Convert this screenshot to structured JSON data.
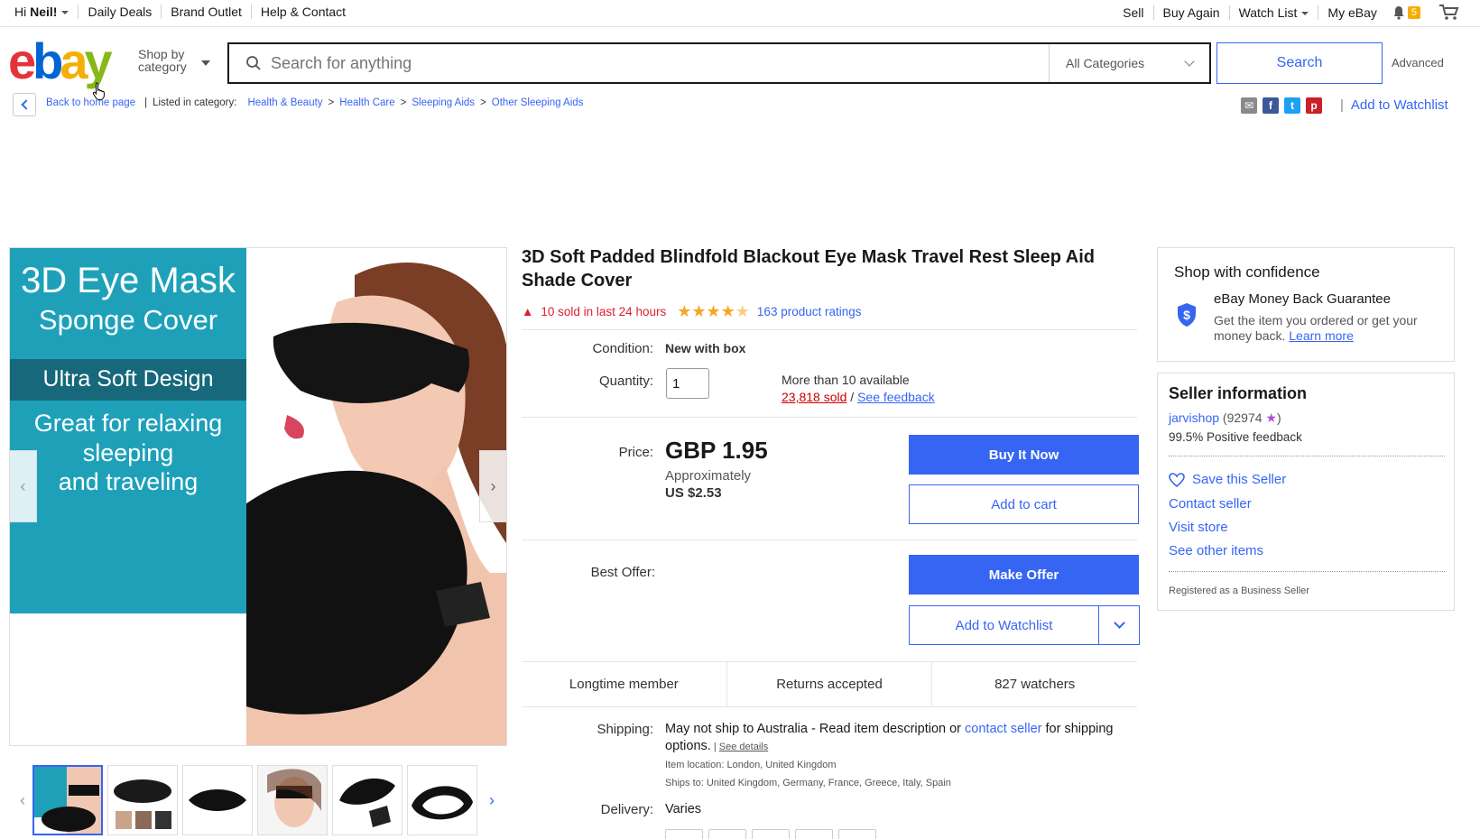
{
  "topbar": {
    "greeting_prefix": "Hi ",
    "greeting_name": "Neil!",
    "links": [
      "Daily Deals",
      "Brand Outlet",
      "Help & Contact"
    ],
    "sell": "Sell",
    "buy_again": "Buy Again",
    "watch_list": "Watch List",
    "my_ebay": "My eBay",
    "notification_count": "5"
  },
  "header": {
    "logo": {
      "e": "e",
      "b": "b",
      "a": "a",
      "y": "y"
    },
    "shop_by_line1": "Shop by",
    "shop_by_line2": "category",
    "search_placeholder": "Search for anything",
    "category": "All Categories",
    "search_button": "Search",
    "advanced": "Advanced"
  },
  "breadcrumb": {
    "back": "Back to home page",
    "listed_in": "Listed in category:",
    "path": [
      "Health & Beauty",
      "Health Care",
      "Sleeping Aids",
      "Other Sleeping Aids"
    ],
    "add_to_watchlist": "Add to Watchlist"
  },
  "gallery": {
    "image_text": {
      "line1": "3D Eye Mask",
      "line2": "Sponge Cover",
      "band": "Ultra Soft Design",
      "line3": "Great for relaxing",
      "line4": "sleeping",
      "line5": "and traveling"
    }
  },
  "item": {
    "title": "3D Soft Padded Blindfold Blackout Eye Mask Travel Rest Sleep Aid Shade Cover",
    "hot_text": "10 sold in last 24 hours",
    "rating_stars": 4.5,
    "ratings_text": "163 product ratings",
    "condition_label": "Condition:",
    "condition": "New with box",
    "quantity_label": "Quantity:",
    "quantity": "1",
    "available": "More than 10 available",
    "sold": "23,818 sold",
    "sold_sep": " / ",
    "see_feedback": "See feedback",
    "price_label": "Price:",
    "price": "GBP 1.95",
    "approx_label": "Approximately",
    "approx_value": "US $2.53",
    "buy_now": "Buy It Now",
    "add_to_cart": "Add to cart",
    "best_offer_label": "Best Offer:",
    "make_offer": "Make Offer",
    "add_to_watchlist": "Add to Watchlist",
    "highlights": [
      "Longtime member",
      "Returns accepted",
      "827 watchers"
    ],
    "shipping_label": "Shipping:",
    "shipping_text": "May not ship to Australia - Read item description or ",
    "contact_seller": "contact seller",
    "shipping_text2": " for shipping options.",
    "see_details": "See details",
    "item_location": "Item location:  London, United Kingdom",
    "ships_to": "Ships to:  United Kingdom, Germany, France, Greece, Italy, Spain",
    "delivery_label": "Delivery:",
    "delivery": "Varies"
  },
  "confidence": {
    "heading": "Shop with confidence",
    "guarantee": "eBay Money Back Guarantee",
    "desc": "Get the item you ordered or get your money back. ",
    "learn_more": "Learn more"
  },
  "seller": {
    "heading": "Seller information",
    "name": "jarvishop",
    "score": " (92974 ",
    "close": ")",
    "positive": "99.5% Positive feedback",
    "save": "Save this Seller",
    "contact": "Contact seller",
    "visit": "Visit store",
    "other": "See other items",
    "registered": "Registered as a Business Seller"
  },
  "colors": {
    "accent": "#3665f3",
    "hot": "#dd1e31",
    "teal": "#1ea1b8"
  }
}
